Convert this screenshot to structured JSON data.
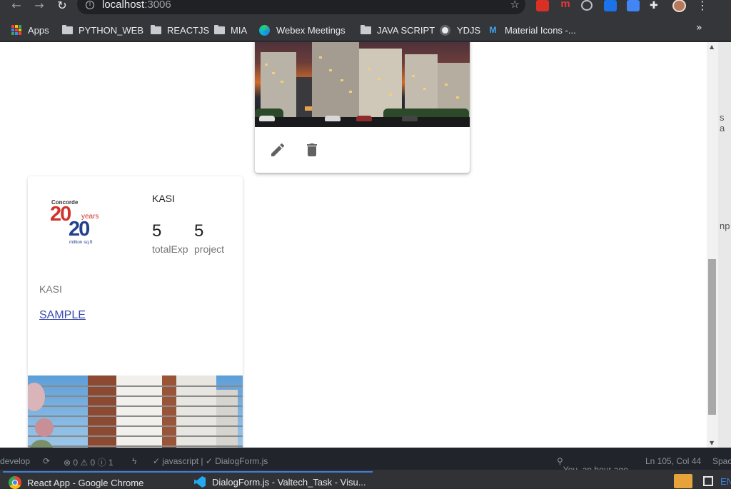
{
  "browser": {
    "url_host": "localhost",
    "url_port": ":3006",
    "bookmarks": [
      {
        "label": "Apps",
        "icon": "apps-grid-icon"
      },
      {
        "label": "PYTHON_WEB",
        "icon": "folder-icon"
      },
      {
        "label": "REACTJS",
        "icon": "folder-icon"
      },
      {
        "label": "MIA",
        "icon": "folder-icon"
      },
      {
        "label": "Webex Meetings",
        "icon": "webex-icon"
      },
      {
        "label": "JAVA SCRIPT",
        "icon": "folder-icon"
      },
      {
        "label": "YDJS",
        "icon": "globe-icon"
      },
      {
        "label": "Material Icons -...",
        "icon": "material-icons-icon"
      }
    ],
    "overflow_label": "»"
  },
  "page": {
    "card_top": {
      "actions": [
        "edit",
        "delete"
      ]
    },
    "card_main": {
      "logo": {
        "brand": "Concorde",
        "num_top": "20",
        "years": "years",
        "num_bottom": "20",
        "sub": "million sq.ft"
      },
      "name": "KASI",
      "stats": [
        {
          "value": "5",
          "label": "totalExp"
        },
        {
          "value": "5",
          "label": "project"
        }
      ],
      "subtitle": "KASI",
      "link": "SAMPLE"
    },
    "right_fragments": [
      "s a",
      "np"
    ]
  },
  "vscode_status": {
    "branch": "develop",
    "problems": "⊗ 0 ⚠ 0 ⓘ 1",
    "language": "✓ javascript | ✓ DialogForm.js",
    "blame": "You, an hour ago",
    "position": "Ln 105, Col 44",
    "spaces": "Spac"
  },
  "taskbar": {
    "items": [
      {
        "label": "React App - Google Chrome",
        "icon": "chrome-icon"
      },
      {
        "label": "DialogForm.js - Valtech_Task - Visu...",
        "icon": "vscode-icon"
      }
    ],
    "tray_text": "EN"
  },
  "colors": {
    "link": "#3949ab",
    "logo_red": "#d0342c",
    "logo_blue": "#24408e"
  }
}
